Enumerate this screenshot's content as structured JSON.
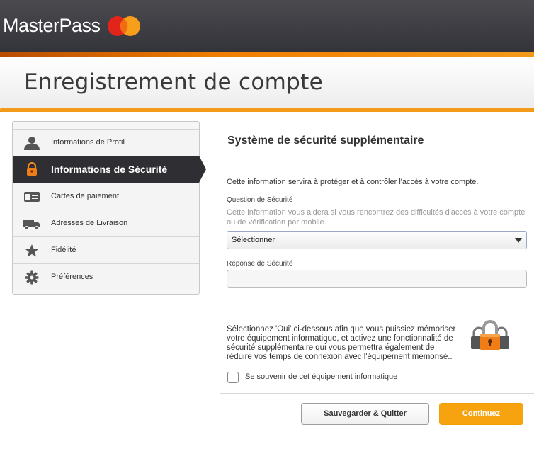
{
  "header": {
    "brand": "MasterPass",
    "brand_colors": {
      "circle_left": "#e1251b",
      "circle_right": "#f79e1b",
      "accent": "#f49a1a"
    }
  },
  "page_title": "Enregistrement de compte",
  "sidebar": {
    "items": [
      {
        "label": "Informations de Profil",
        "icon": "user-icon",
        "active": false
      },
      {
        "label": "Informations de Sécurité",
        "icon": "lock-icon",
        "active": true
      },
      {
        "label": "Cartes de paiement",
        "icon": "card-icon",
        "active": false
      },
      {
        "label": "Adresses de Livraison",
        "icon": "truck-icon",
        "active": false
      },
      {
        "label": "Fidélité",
        "icon": "star-icon",
        "active": false
      },
      {
        "label": "Préférences",
        "icon": "gear-icon",
        "active": false
      }
    ]
  },
  "form": {
    "section_title": "Système de sécurité supplémentaire",
    "info_text": "Cette information servira à protéger et à contrôler l'accès à votre compte.",
    "question_label": "Question de Sécurité",
    "question_help": "Cette information vous aidera si vous rencontrez des difficultés d'accès à votre compte ou de vérification par mobile.",
    "question_selected": "Sélectionner",
    "answer_label": "Réponse de Sécurité",
    "answer_value": "",
    "remember_text": "Sélectionnez 'Oui' ci-dessous afin que vous puissiez mémoriser votre équipement informatique, et activez une fonctionnalité de sécurité supplémentaire qui vous permettra également de réduire vos temps de connexion avec l'équipement mémorisé..",
    "remember_checkbox_label": "Se souvenir de cet équipement informatique",
    "remember_checked": false
  },
  "buttons": {
    "save_quit": "Sauvegarder & Quitter",
    "continue": "Continuez"
  }
}
